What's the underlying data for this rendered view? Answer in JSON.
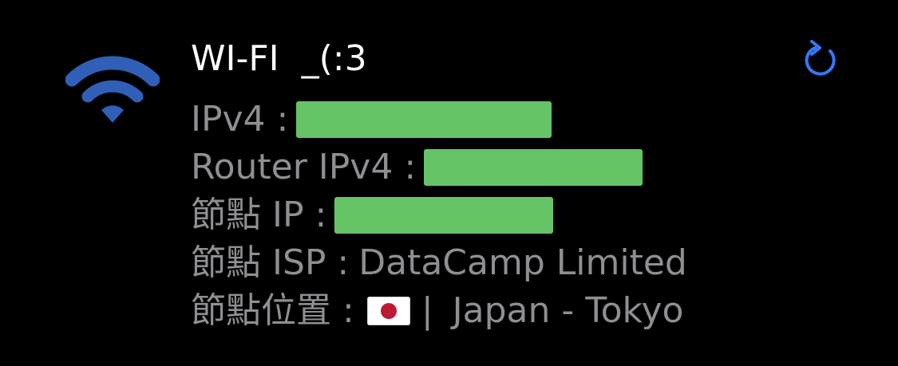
{
  "network": {
    "title": "WI-FI  _(:3",
    "icon": "wifi-icon",
    "refresh_icon": "refresh-icon",
    "accent_color": "#3478f6",
    "wifi_color": "#2f5fb6"
  },
  "rows": {
    "ipv4_label": "IPv4 :",
    "router_label": "Router IPv4 :",
    "node_ip_label": "節點 IP :",
    "node_isp_label": "節點 ISP :",
    "node_isp_value": "DataCamp Limited",
    "node_location_label": "節點位置 :",
    "node_location_flag": "japan-flag-icon",
    "node_location_separator": "|",
    "node_location_value": "Japan - Tokyo"
  },
  "redaction_color": "#65c466"
}
